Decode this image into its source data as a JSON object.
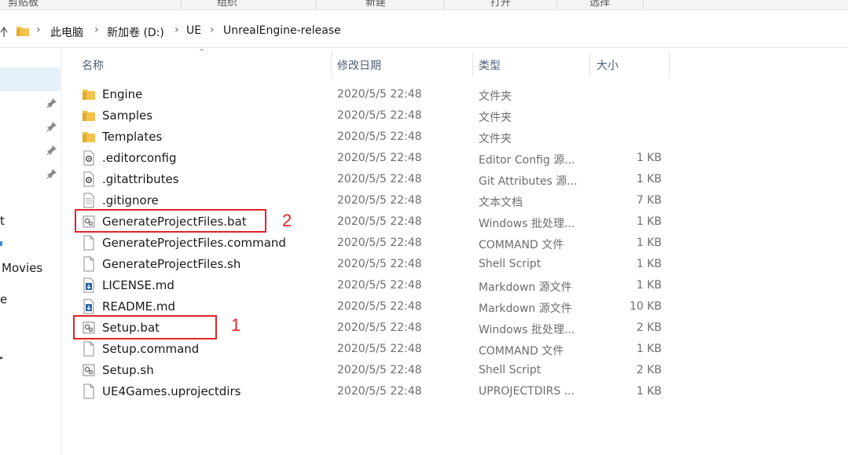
{
  "ribbon": {
    "groups": [
      "剪贴板",
      "组织",
      "新建",
      "打开",
      "选择"
    ]
  },
  "address": {
    "crumbs": [
      "此电脑",
      "新加卷 (D:)",
      "UE",
      "UnrealEngine-release"
    ]
  },
  "nav": {
    "labels": [
      "t",
      "Movies",
      "e"
    ]
  },
  "columns": {
    "name": "名称",
    "date": "修改日期",
    "type": "类型",
    "size": "大小"
  },
  "files": [
    {
      "name": "Engine",
      "date": "2020/5/5 22:48",
      "type": "文件夹",
      "size": "",
      "icon": "folder-icon"
    },
    {
      "name": "Samples",
      "date": "2020/5/5 22:48",
      "type": "文件夹",
      "size": "",
      "icon": "folder-icon"
    },
    {
      "name": "Templates",
      "date": "2020/5/5 22:48",
      "type": "文件夹",
      "size": "",
      "icon": "folder-icon"
    },
    {
      "name": ".editorconfig",
      "date": "2020/5/5 22:48",
      "type": "Editor Config 源...",
      "size": "1 KB",
      "icon": "config-file-icon"
    },
    {
      "name": ".gitattributes",
      "date": "2020/5/5 22:48",
      "type": "Git Attributes 源...",
      "size": "1 KB",
      "icon": "config-file-icon"
    },
    {
      "name": ".gitignore",
      "date": "2020/5/5 22:48",
      "type": "文本文档",
      "size": "7 KB",
      "icon": "text-file-icon"
    },
    {
      "name": "GenerateProjectFiles.bat",
      "date": "2020/5/5 22:48",
      "type": "Windows 批处理...",
      "size": "1 KB",
      "icon": "batch-file-icon"
    },
    {
      "name": "GenerateProjectFiles.command",
      "date": "2020/5/5 22:48",
      "type": "COMMAND 文件",
      "size": "1 KB",
      "icon": "blank-file-icon"
    },
    {
      "name": "GenerateProjectFiles.sh",
      "date": "2020/5/5 22:48",
      "type": "Shell Script",
      "size": "1 KB",
      "icon": "blank-file-icon"
    },
    {
      "name": "LICENSE.md",
      "date": "2020/5/5 22:48",
      "type": "Markdown 源文件",
      "size": "1 KB",
      "icon": "markdown-file-icon"
    },
    {
      "name": "README.md",
      "date": "2020/5/5 22:48",
      "type": "Markdown 源文件",
      "size": "10 KB",
      "icon": "markdown-file-icon"
    },
    {
      "name": "Setup.bat",
      "date": "2020/5/5 22:48",
      "type": "Windows 批处理...",
      "size": "2 KB",
      "icon": "batch-file-icon"
    },
    {
      "name": "Setup.command",
      "date": "2020/5/5 22:48",
      "type": "COMMAND 文件",
      "size": "1 KB",
      "icon": "blank-file-icon"
    },
    {
      "name": "Setup.sh",
      "date": "2020/5/5 22:48",
      "type": "Shell Script",
      "size": "2 KB",
      "icon": "batch-file-icon"
    },
    {
      "name": "UE4Games.uprojectdirs",
      "date": "2020/5/5 22:48",
      "type": "UPROJECTDIRS ...",
      "size": "1 KB",
      "icon": "blank-file-icon"
    }
  ],
  "annotations": {
    "label_1": "1",
    "label_2": "2"
  },
  "colors": {
    "highlight": "#e0252a",
    "selection": "#e5f1fb",
    "folder": "#f3c24a",
    "header_text": "#4c607a"
  }
}
